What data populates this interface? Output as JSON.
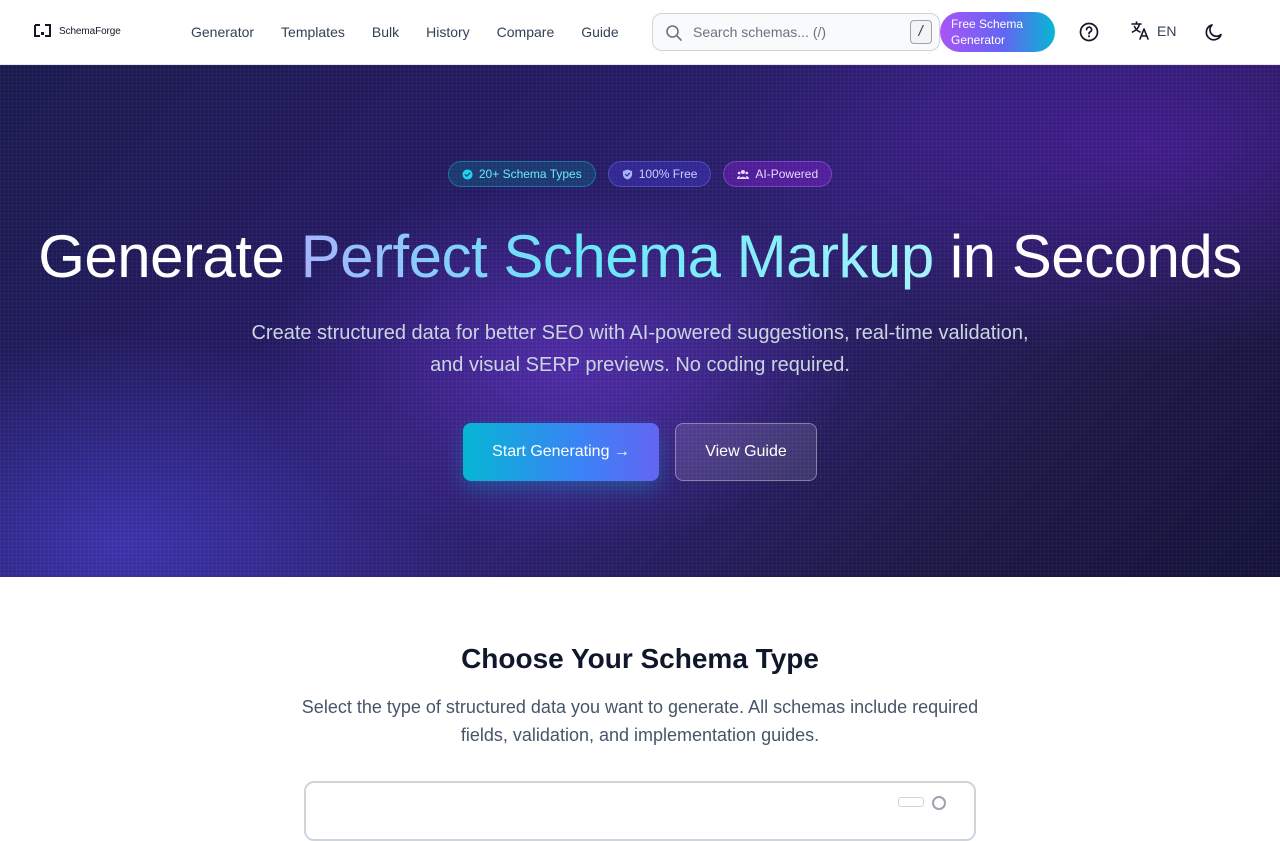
{
  "header": {
    "logo_text": "SchemaForge",
    "nav": [
      "Generator",
      "Templates",
      "Bulk",
      "History",
      "Compare",
      "Guide"
    ],
    "search_placeholder": "Search schemas... (/)",
    "search_shortcut": "/",
    "cta_label": "Free Schema Generator",
    "language": "EN",
    "icons": [
      "search-icon",
      "help-icon",
      "translate-icon",
      "moon-icon"
    ]
  },
  "hero": {
    "badges": [
      {
        "icon": "check-circle-icon",
        "label": "20+ Schema Types"
      },
      {
        "icon": "shield-check-icon",
        "label": "100% Free"
      },
      {
        "icon": "users-icon",
        "label": "AI-Powered"
      }
    ],
    "title_part1": "Generate",
    "title_highlight": "Perfect Schema Markup",
    "title_part2": "in Seconds",
    "subtitle": "Create structured data for better SEO with AI-powered suggestions, real-time validation, and visual SERP previews. No coding required.",
    "primary_button": "Start Generating →",
    "secondary_button": "View Guide"
  },
  "section": {
    "title": "Choose Your Schema Type",
    "subtitle": "Select the type of structured data you want to generate. All schemas include required fields, validation, and implementation guides."
  },
  "colors": {
    "accent_cyan": "#06b6d4",
    "accent_purple": "#a855f7",
    "hero_bg": "#241a63"
  }
}
